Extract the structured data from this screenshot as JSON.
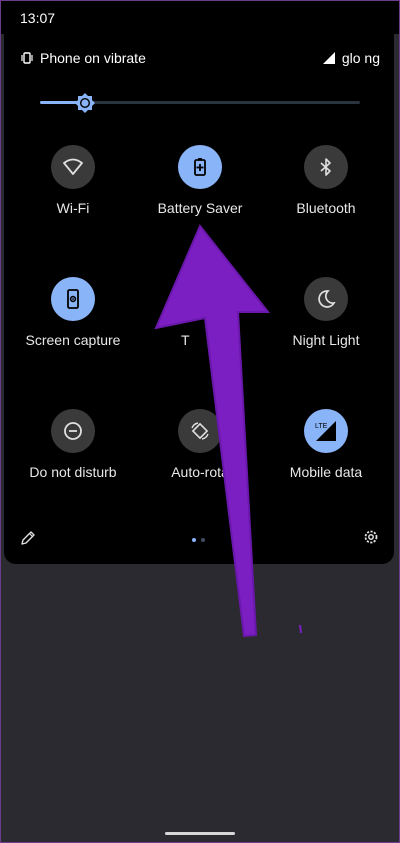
{
  "status_bar": {
    "time": "13:07"
  },
  "quick_settings": {
    "ringer_status": "Phone on vibrate",
    "carrier": "glo ng",
    "brightness_level": 0.14,
    "tiles": [
      {
        "label": "Wi-Fi",
        "icon": "wifi-icon",
        "active": false
      },
      {
        "label": "Battery Saver",
        "icon": "battery-saver-icon",
        "active": true
      },
      {
        "label": "Bluetooth",
        "icon": "bluetooth-icon",
        "active": false
      },
      {
        "label": "Screen capture",
        "icon": "screen-capture-icon",
        "active": true
      },
      {
        "label": "T",
        "icon": "",
        "active": false
      },
      {
        "label": "Night Light",
        "icon": "night-light-icon",
        "active": false
      },
      {
        "label": "Do not disturb",
        "icon": "do-not-disturb-icon",
        "active": false
      },
      {
        "label": "Auto-rota",
        "icon": "auto-rotate-icon",
        "active": false
      },
      {
        "label": "Mobile data",
        "icon": "mobile-data-icon",
        "active": true
      }
    ],
    "page_indicator": {
      "pages": 2,
      "current": 1
    }
  },
  "colors": {
    "accent": "#8ab4f8",
    "annotation_arrow": "#7b1fc2",
    "panel_bg": "#000000",
    "tile_off_bg": "#3a3a3a"
  }
}
